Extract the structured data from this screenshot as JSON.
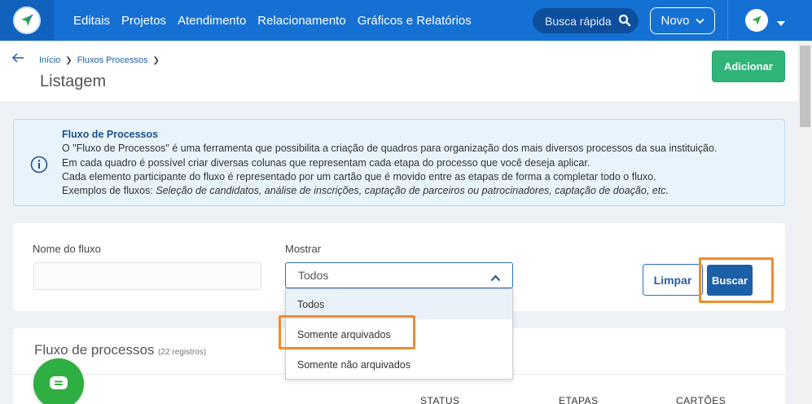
{
  "nav": {
    "items": [
      "Editais",
      "Projetos",
      "Atendimento",
      "Relacionamento",
      "Gráficos e Relatórios"
    ],
    "search_placeholder": "Busca rápida",
    "novo_label": "Novo"
  },
  "header": {
    "breadcrumb": [
      "Início",
      "Fluxos Processos"
    ],
    "title": "Listagem",
    "add_label": "Adicionar"
  },
  "info": {
    "title": "Fluxo de Processos",
    "line1": "O \"Fluxo de Processos\" é uma ferramenta que possibilita a criação de quadros para organização dos mais diversos processos da sua instituição.",
    "line2": "Em cada quadro é possível criar diversas colunas que representam cada etapa do processo que você deseja aplicar.",
    "line3": "Cada elemento participante do fluxo é representado por um cartão que é movido entre as etapas de forma a completar todo o fluxo.",
    "line4_prefix": "Exemplos de fluxos: ",
    "line4_examples": "Seleção de candidatos, análise de inscrições, captação de parceiros ou patrocinadores, captação de doação, etc."
  },
  "filter": {
    "name_label": "Nome do fluxo",
    "name_value": "",
    "show_label": "Mostrar",
    "show_value": "Todos",
    "options": [
      "Todos",
      "Somente arquivados",
      "Somente não arquivados"
    ],
    "clear_label": "Limpar",
    "search_label": "Buscar"
  },
  "list": {
    "title": "Fluxo de processos",
    "count": "(22 registros)",
    "columns": [
      "STATUS",
      "ETAPAS",
      "CARTÕES"
    ]
  },
  "colors": {
    "topbar": "#1570d4",
    "accent_green": "#30b478",
    "highlight": "#f08b2e",
    "primary": "#1a5fa8"
  }
}
